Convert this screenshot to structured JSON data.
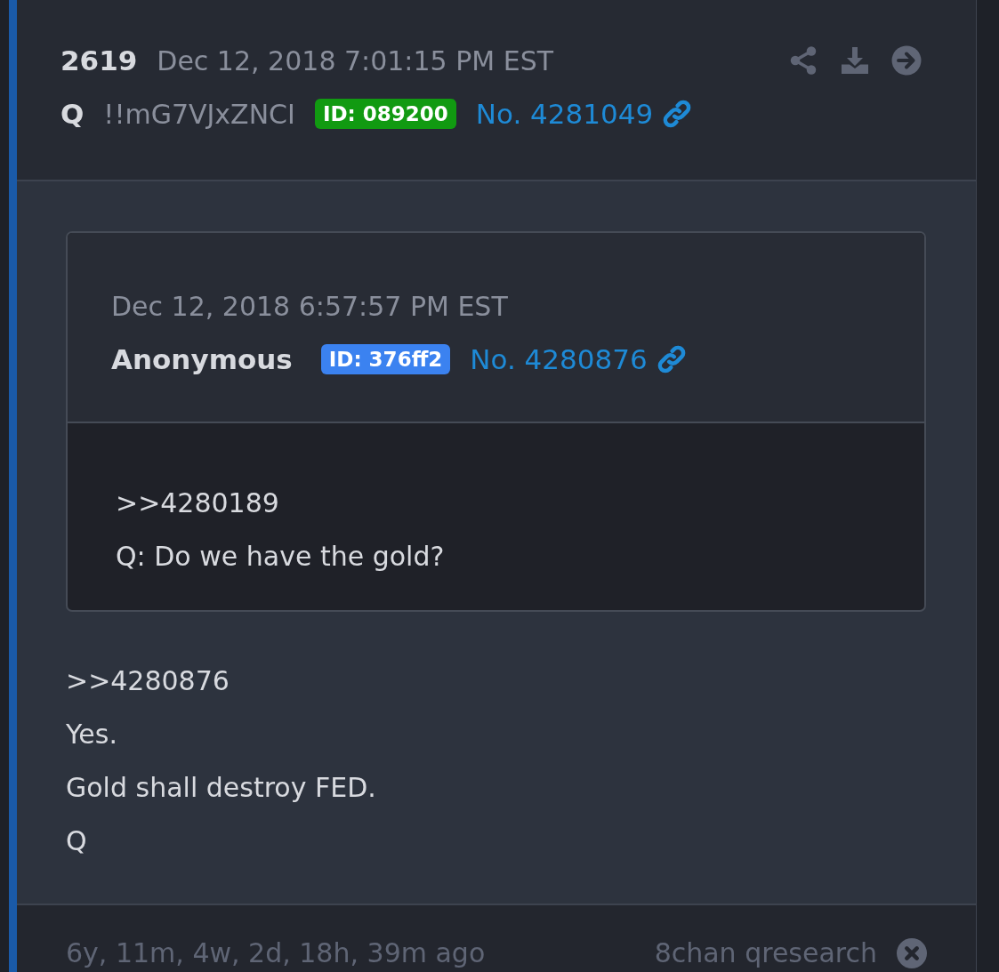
{
  "post": {
    "count": "2619",
    "date": "Dec 12, 2018 7:01:15 PM EST",
    "author": "Q",
    "tripcode": "!!mG7VJxZNCI",
    "id_badge": {
      "label": "ID: 089200",
      "color": "#119a11"
    },
    "number": "No. 4281049"
  },
  "quote": {
    "date": "Dec 12, 2018 6:57:57 PM EST",
    "author": "Anonymous",
    "id_badge": {
      "label": "ID: 376ff2",
      "color": "#3b82f0"
    },
    "number": "No. 4280876",
    "lines": [
      ">>4280189",
      "Q: Do we have the gold?"
    ]
  },
  "lines": [
    ">>4280876",
    "Yes.",
    "Gold shall destroy FED.",
    "Q"
  ],
  "footer": {
    "age": "6y, 11m, 4w, 2d, 18h, 39m ago",
    "source": "8chan qresearch"
  }
}
